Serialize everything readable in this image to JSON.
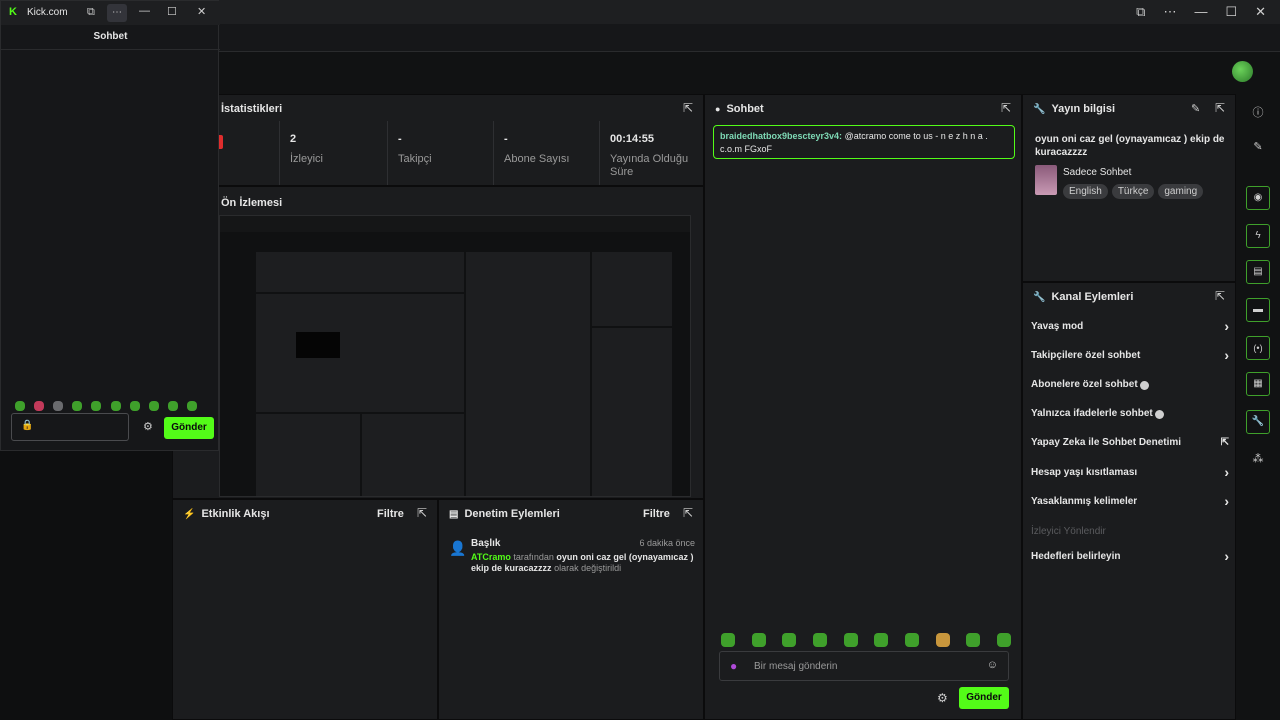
{
  "main_window": {
    "title_buttons": [
      "⧉",
      "⋯",
      "—",
      "☐",
      "✕"
    ]
  },
  "stats": {
    "title": "İstatistikleri",
    "items": [
      {
        "value": "2",
        "label": "İzleyici"
      },
      {
        "value": "-",
        "label": "Takipçi"
      },
      {
        "value": "-",
        "label": "Abone Sayısı"
      },
      {
        "value": "00:14:55",
        "label": "Yayında Olduğu Süre"
      }
    ]
  },
  "preview": {
    "title": "Ön İzlemesi"
  },
  "activity": {
    "title": "Etkinlik Akışı",
    "filter": "Filtre"
  },
  "moderation": {
    "title": "Denetim Eylemleri",
    "filter": "Filtre",
    "item": {
      "heading": "Başlık",
      "time": "6 dakika önce",
      "user": "ATCramo",
      "by": "tarafından",
      "new_title": "oyun oni caz gel (oynayamıcaz ) ekip de kuracazzzz",
      "suffix": "olarak değiştirildi"
    }
  },
  "chat": {
    "title": "Sohbet",
    "message": {
      "user": "braidedhatbox9bescteyr3v4:",
      "text": "@atcramo come to us - n e z h n a . c.o.m FGxoF"
    },
    "input_placeholder": "Bir mesaj gönderin",
    "send": "Gönder"
  },
  "stream_info": {
    "title": "Yayın bilgisi",
    "stream_title": "oyun oni caz gel (oynayamıcaz ) ekip de kuracazzzz",
    "category": "Sadece Sohbet",
    "tags": [
      "English",
      "Türkçe",
      "gaming"
    ]
  },
  "channel_actions": {
    "title": "Kanal Eylemleri",
    "items": [
      {
        "label": "Yavaş mod",
        "control": "chevron"
      },
      {
        "label": "Takipçilere özel sohbet",
        "control": "chevron"
      },
      {
        "label": "Abonelere özel sohbet",
        "control": "toggle"
      },
      {
        "label": "Yalnızca ifadelerle sohbet",
        "control": "toggle"
      },
      {
        "label": "Yapay Zeka ile Sohbet Denetimi",
        "control": "external"
      },
      {
        "label": "Hesap yaşı kısıtlaması",
        "control": "chevron"
      },
      {
        "label": "Yasaklanmış kelimeler",
        "control": "chevron"
      },
      {
        "label": "İzleyici Yönlendir",
        "control": "none",
        "disabled": true
      },
      {
        "label": "Hedefleri belirleyin",
        "control": "chevron"
      }
    ]
  },
  "popout": {
    "app_title": "Kick.com",
    "header": "Sohbet",
    "send": "Gönder"
  },
  "colors": {
    "accent": "#53fc18",
    "panel": "#1b1c1e",
    "bg": "#0b0b0c"
  }
}
